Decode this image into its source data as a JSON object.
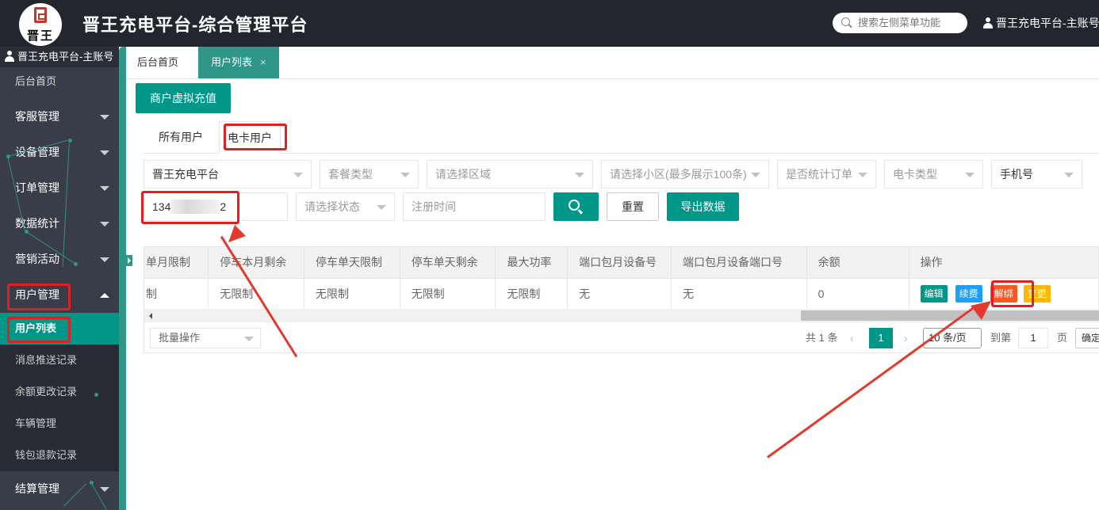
{
  "header": {
    "logo_text": "晋王",
    "title": "晋王充电平台-综合管理平台",
    "search_placeholder": "搜索左侧菜单功能",
    "user": "晋王充电平台-主账号"
  },
  "sidebar": {
    "user": "晋王充电平台-主账号",
    "home": "后台首页",
    "items": [
      {
        "label": "客服管理"
      },
      {
        "label": "设备管理"
      },
      {
        "label": "订单管理"
      },
      {
        "label": "数据统计"
      },
      {
        "label": "营销活动"
      },
      {
        "label": "用户管理"
      }
    ],
    "submenu": [
      {
        "label": "用户列表"
      },
      {
        "label": "消息推送记录"
      },
      {
        "label": "余额更改记录"
      },
      {
        "label": "车辆管理"
      },
      {
        "label": "钱包退款记录"
      }
    ],
    "last_item": "结算管理"
  },
  "tabs": {
    "home": "后台首页",
    "active": "用户列表",
    "close": "×"
  },
  "recharge_button": "商户虚拟充值",
  "user_tabs": [
    "所有用户",
    "电卡用户"
  ],
  "filters": {
    "platform": "晋王充电平台",
    "package_type": "套餐类型",
    "region": "请选择区域",
    "community": "请选择小区(最多展示100条)",
    "count_order": "是否统计订单",
    "card_type": "电卡类型",
    "phone_label": "手机号",
    "phone_value_start": "134",
    "phone_value_end": "2",
    "status": "请选择状态",
    "register_time": "注册时间",
    "reset": "重置",
    "export": "导出数据"
  },
  "table": {
    "headers": [
      "单月限制",
      "停车本月剩余",
      "停车单天限制",
      "停车单天剩余",
      "最大功率",
      "端口包月设备号",
      "端口包月设备端口号",
      "余额",
      "操作"
    ],
    "rows": [
      [
        "制",
        "无限制",
        "无限制",
        "无限制",
        "无限制",
        "无",
        "无",
        "0"
      ]
    ],
    "actions": {
      "edit": "编辑",
      "renew": "续费",
      "unbind": "解绑",
      "change": "变更"
    }
  },
  "footer": {
    "batch": "批量操作",
    "total": "共 1 条",
    "current_page": "1",
    "page_size": "10 条/页",
    "goto": "到第",
    "goto_value": "1",
    "page_unit": "页",
    "confirm": "确定"
  },
  "colors": {
    "header_bg": "#23262e",
    "sidebar_bg": "#393d49",
    "accent": "#009688",
    "edit": "#009688",
    "renew": "#1e9fff",
    "unbind": "#ff5722",
    "change": "#ffb800",
    "annotation": "#e02020"
  }
}
